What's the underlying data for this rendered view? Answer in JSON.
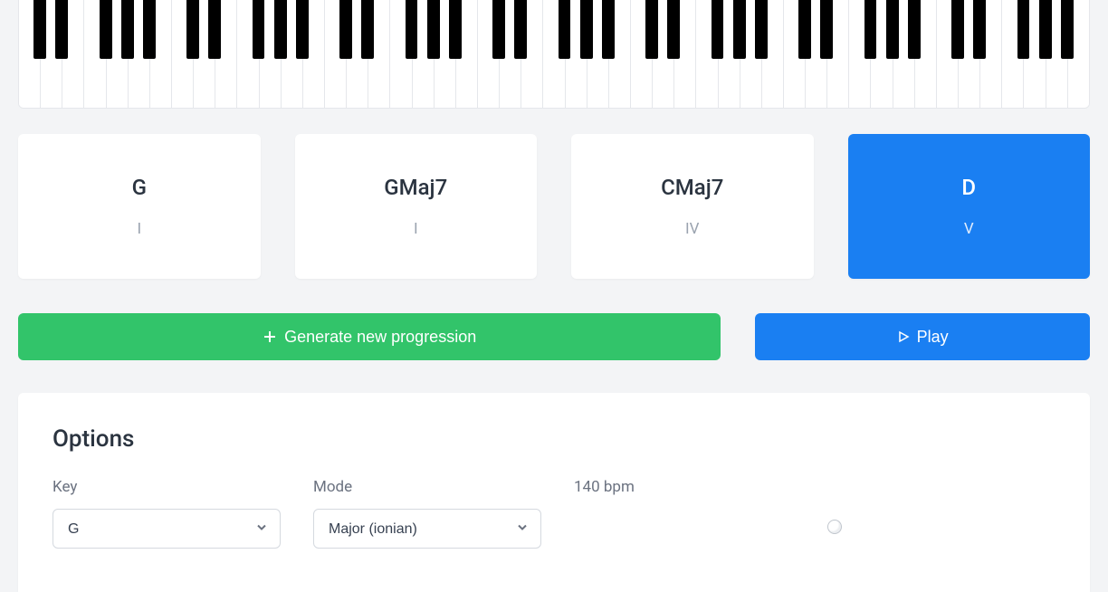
{
  "piano": {
    "octaves": 7,
    "black_key_pattern": [
      true,
      true,
      false,
      true,
      true,
      true,
      false
    ]
  },
  "chords": [
    {
      "name": "G",
      "degree": "I",
      "active": false
    },
    {
      "name": "GMaj7",
      "degree": "I",
      "active": false
    },
    {
      "name": "CMaj7",
      "degree": "IV",
      "active": false
    },
    {
      "name": "D",
      "degree": "V",
      "active": true
    }
  ],
  "buttons": {
    "generate_label": "Generate new progression",
    "play_label": "Play"
  },
  "options": {
    "title": "Options",
    "key_label": "Key",
    "key_value": "G",
    "mode_label": "Mode",
    "mode_value": "Major (ionian)",
    "bpm_label": "140 bpm"
  },
  "colors": {
    "accent_blue": "#1a7ff2",
    "accent_green": "#32c46a"
  }
}
